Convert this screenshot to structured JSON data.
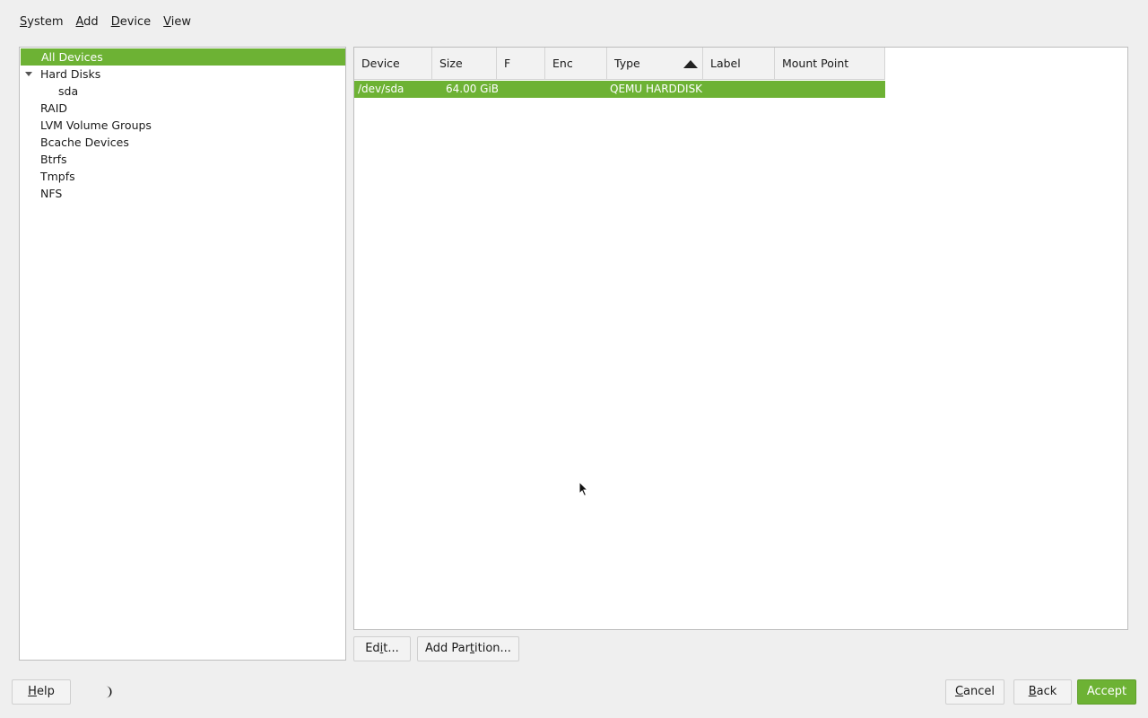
{
  "menu": {
    "items": [
      {
        "label": "System",
        "mnemonic": "S",
        "rest": "ystem"
      },
      {
        "label": "Add",
        "mnemonic": "A",
        "rest": "dd"
      },
      {
        "label": "Device",
        "mnemonic": "D",
        "rest": "evice"
      },
      {
        "label": "View",
        "mnemonic": "V",
        "rest": "iew"
      }
    ]
  },
  "tree": {
    "items": [
      {
        "label": "All Devices"
      },
      {
        "label": "Hard Disks"
      },
      {
        "label": "sda"
      },
      {
        "label": "RAID"
      },
      {
        "label": "LVM Volume Groups"
      },
      {
        "label": "Bcache Devices"
      },
      {
        "label": "Btrfs"
      },
      {
        "label": "Tmpfs"
      },
      {
        "label": "NFS"
      }
    ]
  },
  "table": {
    "columns": [
      "Device",
      "Size",
      "F",
      "Enc",
      "Type",
      "Label",
      "Mount Point"
    ],
    "sorted_column": "Type",
    "rows": [
      {
        "device": "/dev/sda",
        "size": "64.00 GiB",
        "f": "",
        "enc": "",
        "type": "QEMU HARDDISK",
        "label": "",
        "mount": ""
      }
    ]
  },
  "actions": {
    "edit": {
      "pre": "Ed",
      "mnemonic": "i",
      "post": "t..."
    },
    "add_partition": {
      "pre": "Add Par",
      "mnemonic": "t",
      "post": "ition..."
    }
  },
  "footer": {
    "help": {
      "mnemonic": "H",
      "rest": "elp"
    },
    "cancel": {
      "mnemonic": "C",
      "rest": "ancel"
    },
    "back": {
      "mnemonic": "B",
      "rest": "ack"
    },
    "accept": {
      "label": "Accept"
    }
  },
  "colors": {
    "accent": "#6db234",
    "background": "#efefef",
    "panel": "#ffffff"
  },
  "icons": {
    "theme_toggle": "moon-icon",
    "cursor": "mouse-pointer-icon",
    "tree_expander": "triangle-down-icon",
    "sort": "sort-ascending-icon"
  }
}
